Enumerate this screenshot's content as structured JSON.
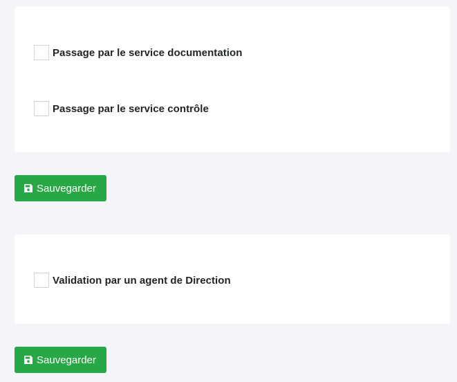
{
  "section_1": {
    "checkboxes": [
      {
        "label": "Passage par le service documentation",
        "checked": false
      },
      {
        "label": "Passage par le service contrôle",
        "checked": false
      }
    ],
    "save_button": {
      "label": "Sauvegarder",
      "icon": "floppy-disk-icon",
      "color": "#28a745"
    }
  },
  "section_2": {
    "checkboxes": [
      {
        "label": "Validation par un agent de Direction",
        "checked": false
      }
    ],
    "save_button": {
      "label": "Sauvegarder",
      "icon": "floppy-disk-icon",
      "color": "#28a745"
    }
  }
}
